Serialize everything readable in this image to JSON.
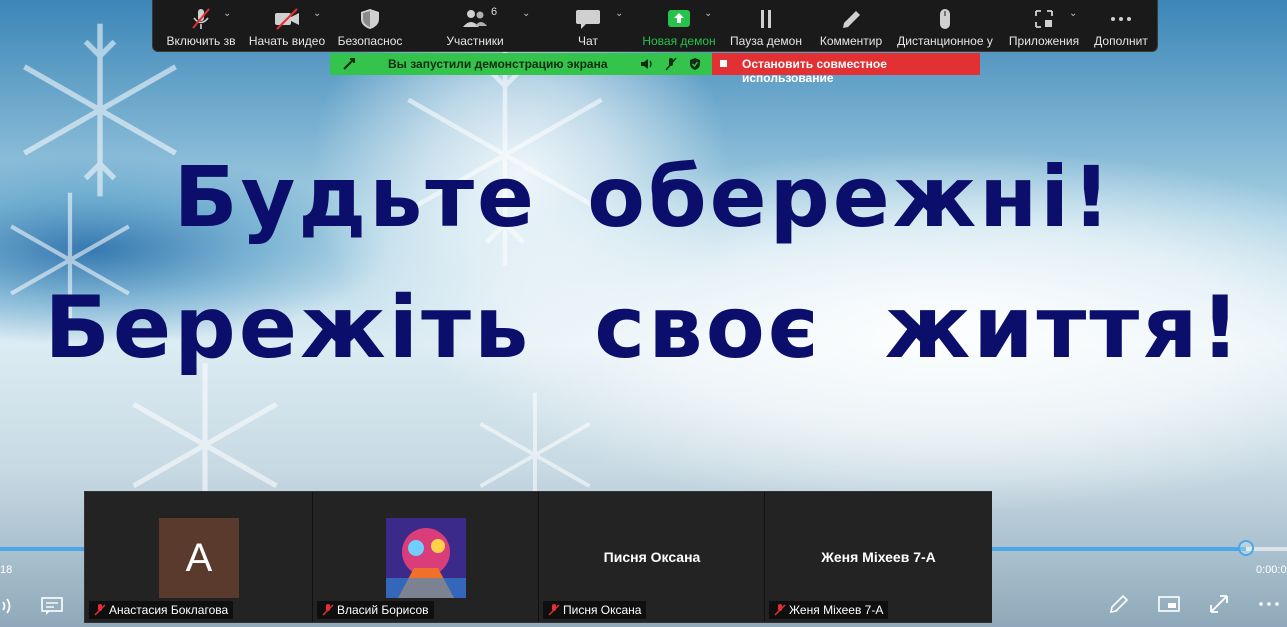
{
  "toolbar": {
    "mute_label": "Включить зв",
    "video_label": "Начать видео",
    "security_label": "Безопаснос",
    "participants_label": "Участники",
    "participants_count": "6",
    "chat_label": "Чат",
    "new_share_label": "Новая демон",
    "pause_label": "Пауза демон",
    "comment_label": "Комментир",
    "remote_label": "Дистанционное у",
    "apps_label": "Приложения",
    "more_label": "Дополнит"
  },
  "share_banner": {
    "text": "Вы запустили демонстрацию экрана",
    "stop_label": "Остановить совместное использование"
  },
  "slide": {
    "line1": "Будьте обережні!",
    "line2": "Бережіть своє життя!"
  },
  "player": {
    "time_elapsed": "18",
    "time_total": "0:00:0"
  },
  "participants": [
    {
      "name": "Анастасия Боклагова",
      "avatar_letter": "A"
    },
    {
      "name": "Власий Борисов"
    },
    {
      "name": "Писня Оксана",
      "display": "Писня Оксана"
    },
    {
      "name": "Женя Міхеев 7-А",
      "display": "Женя Міхеев 7-А"
    }
  ],
  "colors": {
    "toolbar_bg": "#1a1a1a",
    "share_green": "#34c34b",
    "stop_red": "#e33033",
    "slide_text": "#0b0f6b",
    "progress_blue": "#4aa8e8"
  }
}
